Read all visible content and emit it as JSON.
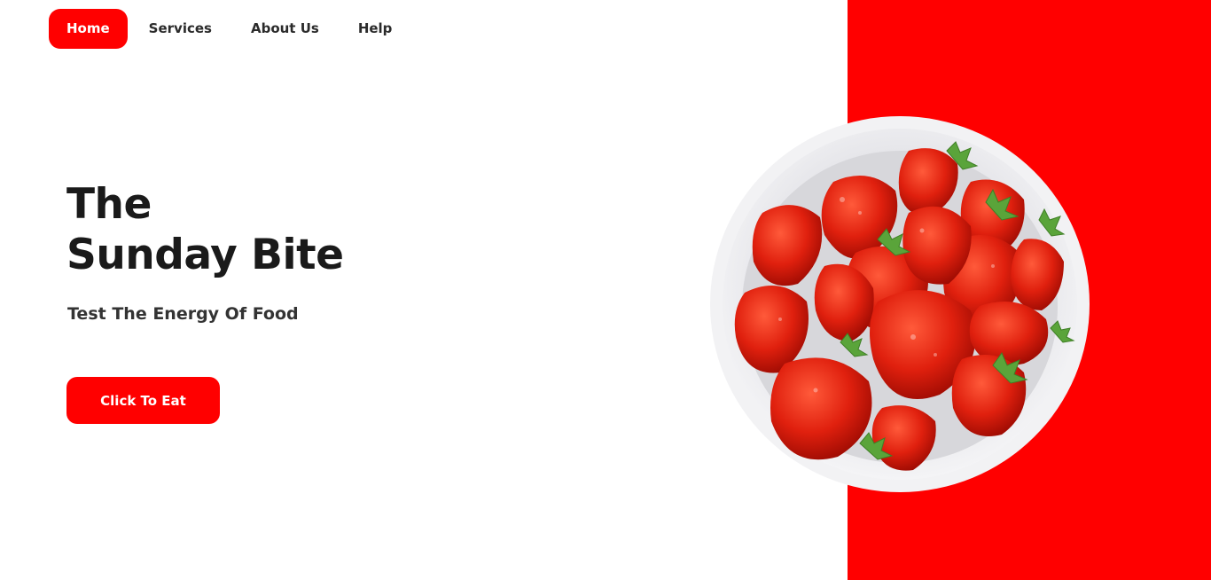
{
  "nav": {
    "items": [
      {
        "label": "Home",
        "active": true
      },
      {
        "label": "Services",
        "active": false
      },
      {
        "label": "About Us",
        "active": false
      },
      {
        "label": "Help",
        "active": false
      }
    ]
  },
  "hero": {
    "title_line1": "The",
    "title_line2": "Sunday Bite",
    "tagline": "Test The Energy Of Food",
    "cta_label": "Click To Eat"
  },
  "image": {
    "subject": "bowl of strawberries"
  },
  "colors": {
    "accent": "#ff0000",
    "text_dark": "#1a1a1a",
    "background": "#ffffff"
  }
}
